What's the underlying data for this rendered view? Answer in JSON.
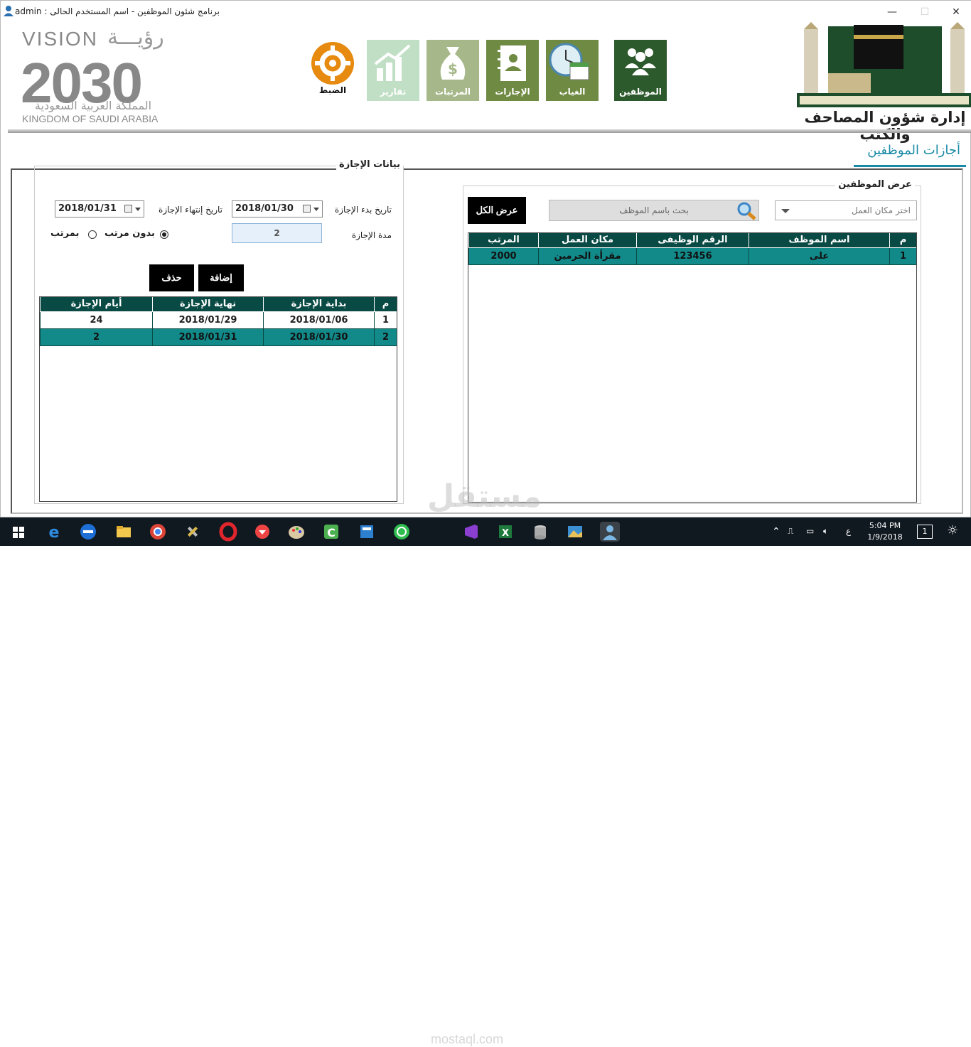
{
  "titlebar": {
    "user": "admin",
    "title": "برنامج شئون الموظفين   -   اسم المستخدم الحالى  :",
    "minimize": "—",
    "maximize": "☐",
    "close": "✕"
  },
  "header": {
    "vision_title": "VISION",
    "vision_ar_logo": "رؤيـــة",
    "vision_year": "2030",
    "vision_ar": "المملكة العربية السعودية",
    "vision_en": "KINGDOM OF SAUDI ARABIA",
    "org_name": "إدارة شؤون المصاحف والكتب"
  },
  "tiles": [
    {
      "label": "الموظفين",
      "color": "#2d5a2c",
      "icon": "people-icon"
    },
    {
      "label": "الغياب",
      "color": "#6f8a43",
      "icon": "clock-calendar-icon"
    },
    {
      "label": "الإجازات",
      "color": "#6f8a43",
      "icon": "contact-book-icon"
    },
    {
      "label": "المرتبات",
      "color": "#a6b889",
      "icon": "money-bag-icon"
    },
    {
      "label": "تقارير",
      "color": "#c0dfc5",
      "icon": "bar-chart-icon"
    },
    {
      "label": "الضبط",
      "color": "#e68a10",
      "icon": "gear-icon"
    }
  ],
  "page_title": "أجازات الموظفين",
  "employees_panel": {
    "title": "عرض الموظفين",
    "workplace_placeholder": "اختر مكان العمل",
    "search_placeholder": "بحث باسم الموظف",
    "show_all_label": "عرض الكل",
    "columns": [
      "م",
      "اسم الموظف",
      "الرقم الوظيفى",
      "مكان العمل",
      "المرتب"
    ],
    "rows": [
      [
        "1",
        "على",
        "123456",
        "مقرأة الحرمين",
        "2000"
      ]
    ]
  },
  "vacation_panel": {
    "title": "بيانات الإجازة",
    "start_label": "تاريخ بدء الإجازة",
    "start_value": "2018/01/30",
    "end_label": "تاريخ إنتهاء الإجازة",
    "end_value": "2018/01/31",
    "duration_label": "مدة الإجازة",
    "duration_value": "2",
    "radio_without_salary": "بدون مرتب",
    "radio_with_salary": "بمرتب",
    "add_label": "إضافة",
    "delete_label": "حذف",
    "columns": [
      "م",
      "بداية الإجازة",
      "نهاية الإجازة",
      "أيام الإجازة"
    ],
    "rows": [
      [
        "1",
        "2018/01/06",
        "2018/01/29",
        "24"
      ],
      [
        "2",
        "2018/01/30",
        "2018/01/31",
        "2"
      ]
    ]
  },
  "watermark": {
    "ar": "مستقل",
    "en": "mostaql.com"
  },
  "taskbar": {
    "time": "5:04 PM",
    "date": "1/9/2018",
    "lang": "ع",
    "notifications": "1"
  }
}
